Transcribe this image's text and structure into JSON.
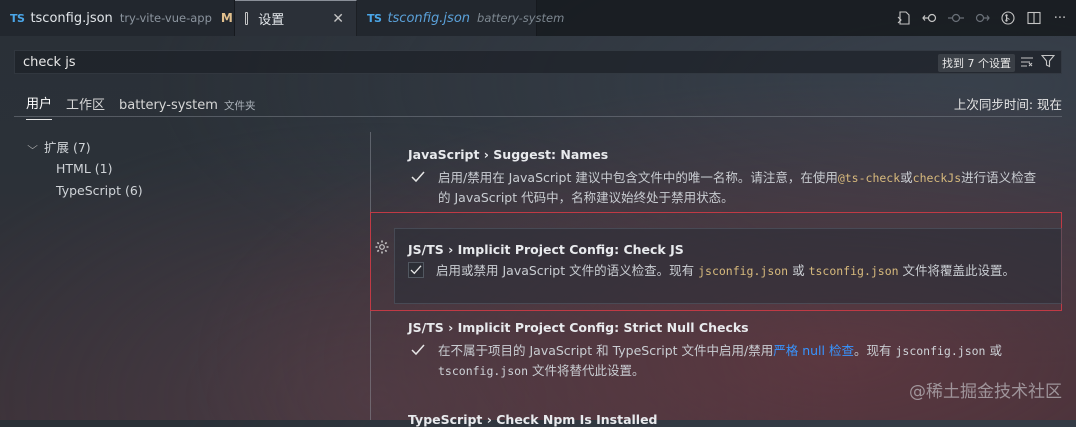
{
  "tabs": [
    {
      "icon": "TS",
      "title": "tsconfig.json",
      "description": "try-vite-vue-app",
      "modified": "M"
    },
    {
      "title": "设置"
    },
    {
      "icon": "TS",
      "title": "tsconfig.json",
      "description": "battery-system"
    }
  ],
  "toolbar": {
    "icons": [
      "open-json-icon",
      "go-back-icon",
      "circle-icon",
      "go-forward-icon",
      "branch-icon",
      "split-editor-icon",
      "more-icon"
    ]
  },
  "search": {
    "value": "check js",
    "result_count": "找到 7 个设置"
  },
  "scopes": {
    "user": "用户",
    "workspace": "工作区",
    "folder": "battery-system",
    "folder_hint": "文件夹",
    "sync_status": "上次同步时间: 现在"
  },
  "toc": {
    "extensions": "扩展 (7)",
    "html": "HTML (1)",
    "typescript": "TypeScript (6)"
  },
  "settings": [
    {
      "category": "JavaScript › Suggest: ",
      "name": "Names",
      "checked": true,
      "desc_parts": [
        "启用/禁用在 JavaScript 建议中包含文件中的唯一名称。请注意，在使用",
        "@ts-check",
        "或",
        "checkJs",
        "进行语义检查",
        "的 JavaScript 代码中，名称建议始终处于禁用状态。"
      ]
    },
    {
      "category": "JS/TS › Implicit Project Config: ",
      "name": "Check JS",
      "checked": true,
      "desc_parts": [
        "启用或禁用 JavaScript 文件的语义检查。现有 ",
        "jsconfig.json",
        " 或 ",
        "tsconfig.json",
        " 文件将覆盖此设置。"
      ]
    },
    {
      "category": "JS/TS › Implicit Project Config: ",
      "name": "Strict Null Checks",
      "checked": true,
      "desc_parts": [
        "在不属于项目的 JavaScript 和 TypeScript 文件中启用/禁用",
        "严格 null 检查",
        "。现有 ",
        "jsconfig.json",
        " 或",
        "tsconfig.json",
        " 文件将替代此设置。"
      ]
    }
  ],
  "next_setting_partial": "TypeScript › Check Npm Is Installed",
  "watermark": "@稀土掘金技术社区",
  "colors": {
    "accent_link": "#3794ff",
    "focus_border": "#c03a45",
    "code": "#d7ba7d",
    "ts_icon": "#4aa6e8",
    "modified": "#e2c08d"
  }
}
